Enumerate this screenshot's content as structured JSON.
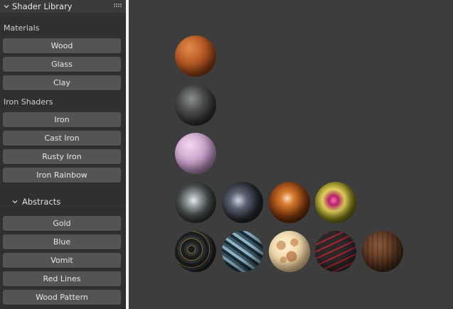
{
  "panel": {
    "title": "Shader Library",
    "materials_label": "Materials",
    "materials": [
      "Wood",
      "Glass",
      "Clay"
    ],
    "iron_label": "Iron Shaders",
    "iron": [
      "Iron",
      "Cast Iron",
      "Rusty Iron",
      "Iron Rainbow"
    ],
    "abstracts": {
      "title": "Abstracts",
      "items": [
        "Gold",
        "Blue",
        "Vomit",
        "Red Lines",
        "Wood Pattern"
      ]
    }
  },
  "icons": {
    "panel_collapse": "chevron-down-icon",
    "drag_handle": "grip-dots-icon",
    "subpanel_collapse": "chevron-down-icon"
  },
  "previews": [
    {
      "name": "wood-preview",
      "color": "#b85a24"
    },
    {
      "name": "glass-preview",
      "color": "#3c3c3c"
    },
    {
      "name": "clay-preview",
      "color": "#c7a0c9"
    },
    {
      "name": "iron-preview",
      "color": "#6b6e6e"
    },
    {
      "name": "cast-iron-preview",
      "color": "#2a2c33"
    },
    {
      "name": "rusty-iron-preview",
      "color": "#8a3f12"
    },
    {
      "name": "iron-rainbow-preview",
      "color": "#7e7a1a"
    },
    {
      "name": "gold-preview",
      "color": "#2f3131"
    },
    {
      "name": "blue-preview",
      "color": "#3e5968"
    },
    {
      "name": "vomit-preview",
      "color": "#f0d9aa"
    },
    {
      "name": "red-lines-preview",
      "color": "#3a3436"
    },
    {
      "name": "wood-pattern-preview",
      "color": "#5b3722"
    }
  ]
}
